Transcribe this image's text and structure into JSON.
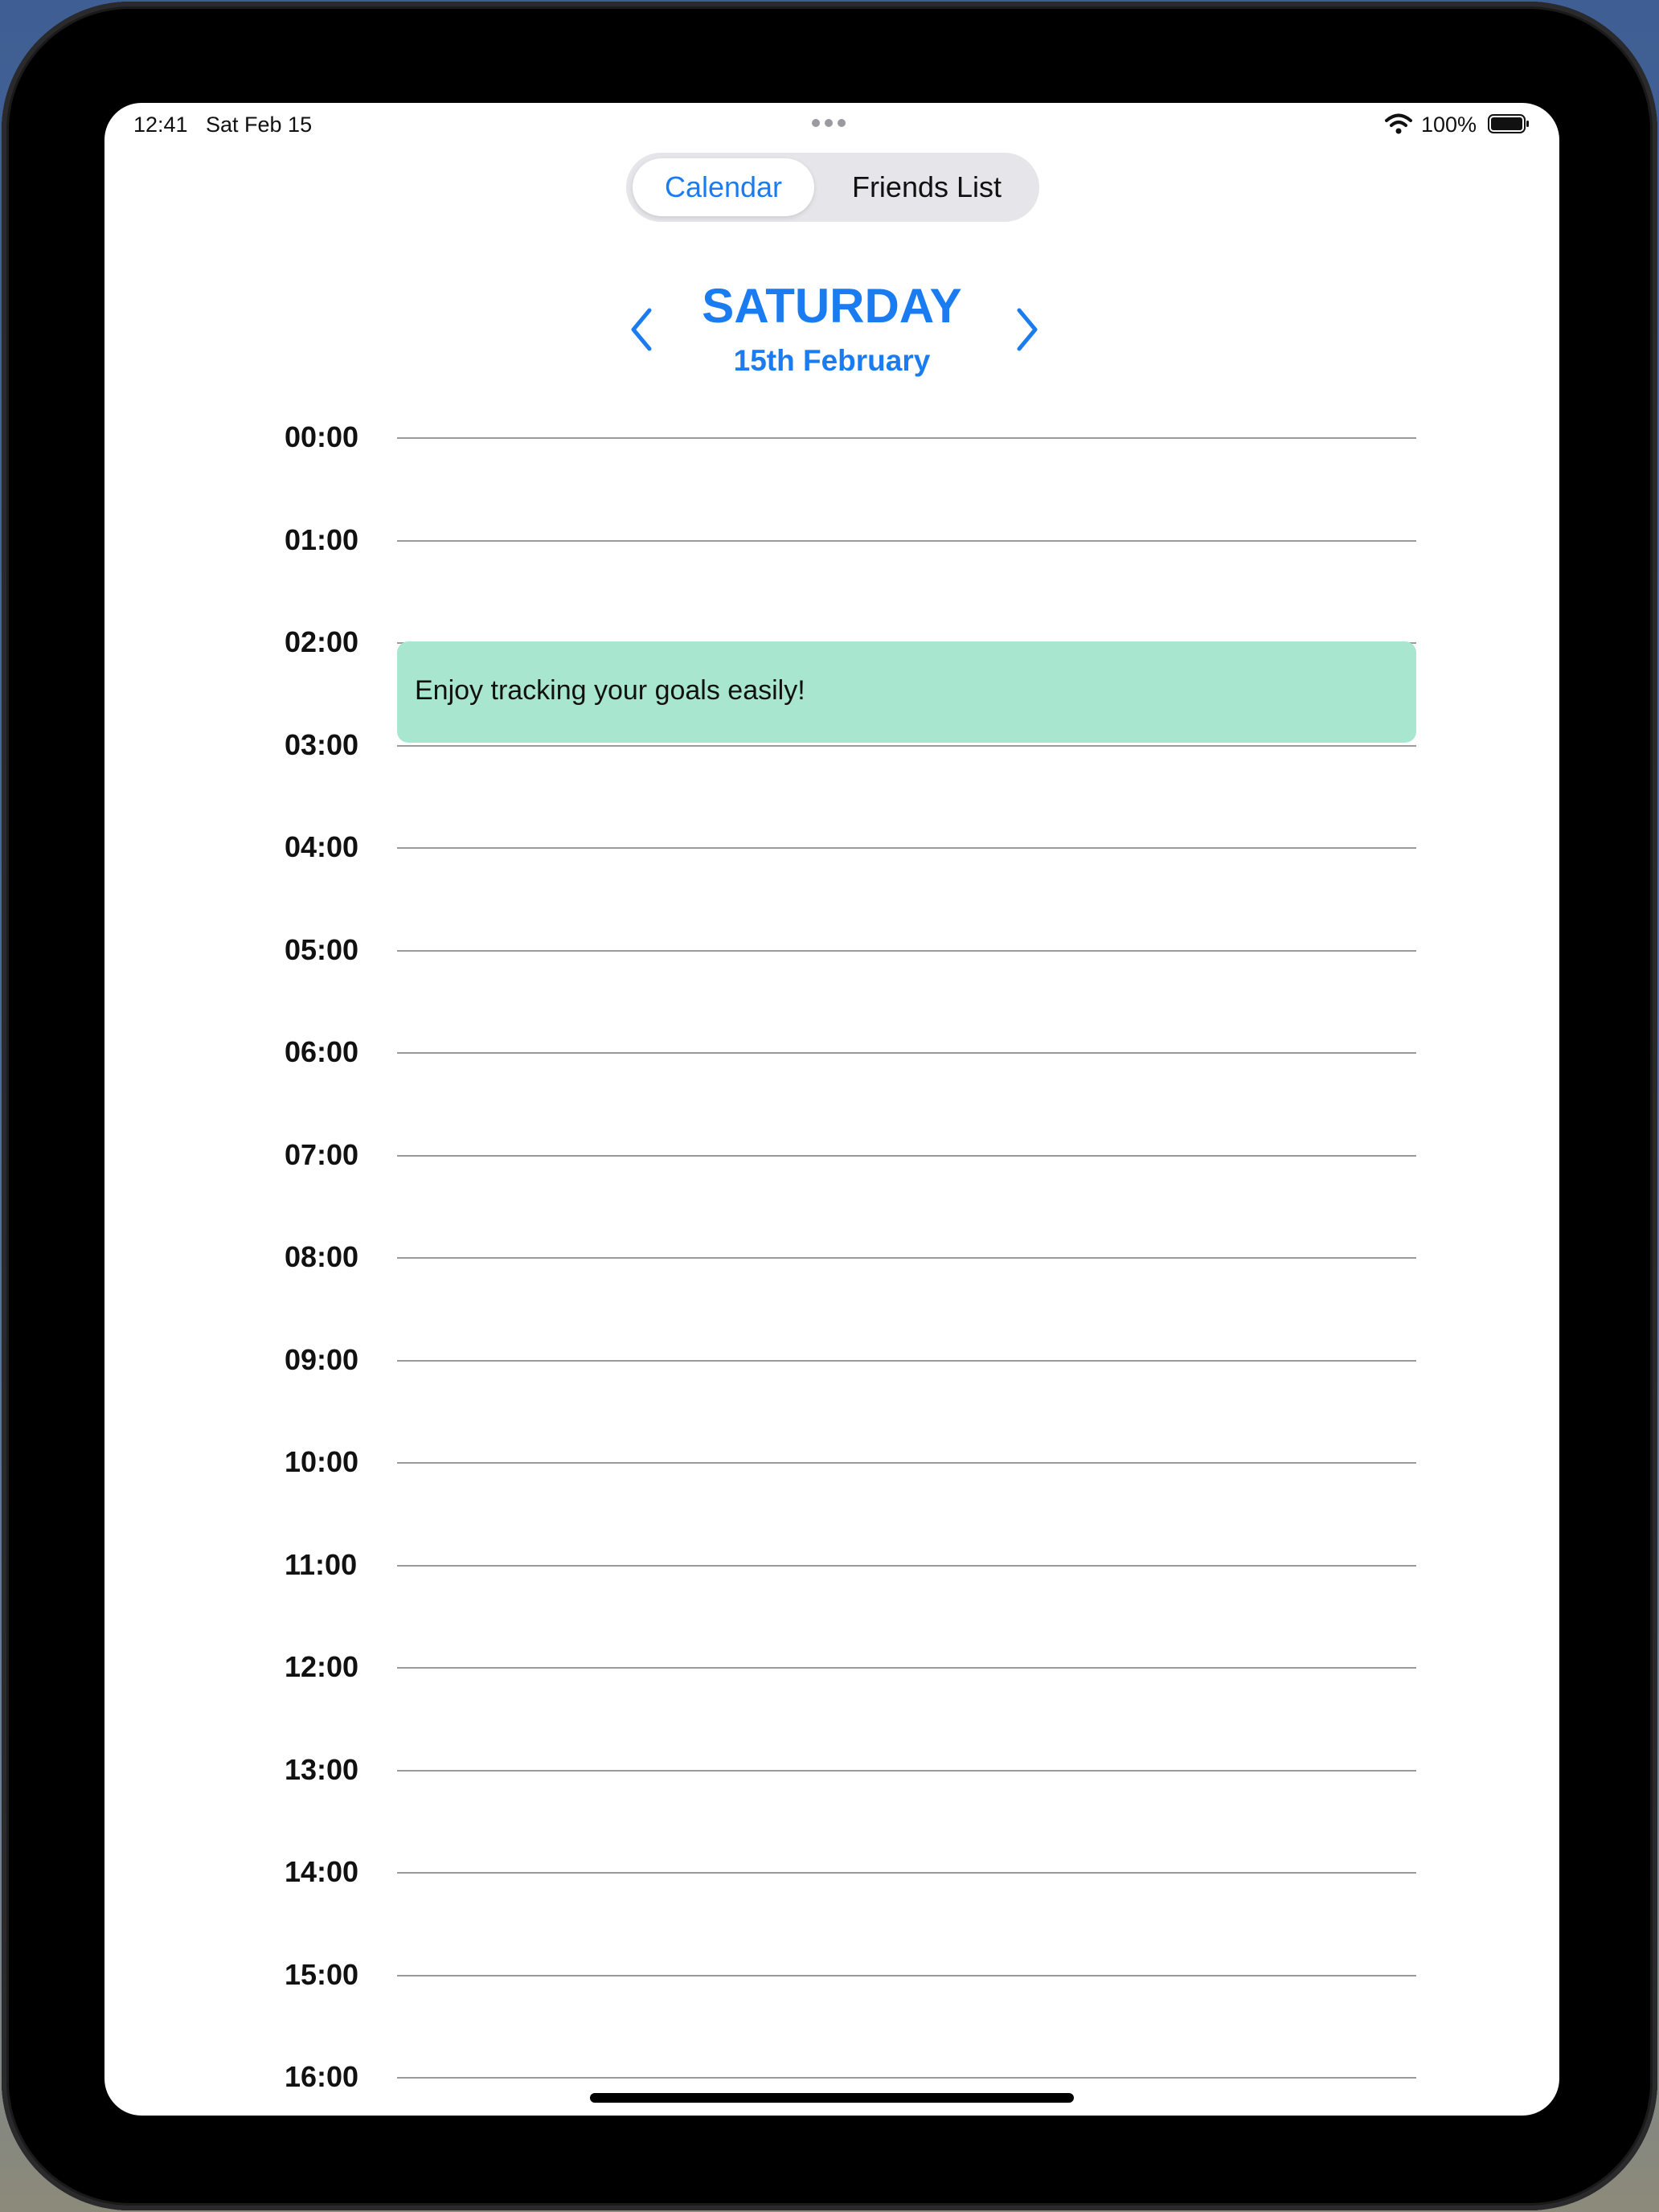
{
  "status_bar": {
    "time": "12:41",
    "date": "Sat Feb 15",
    "battery": "100%"
  },
  "segmented_control": {
    "tabs": [
      {
        "label": "Calendar",
        "selected": true
      },
      {
        "label": "Friends List",
        "selected": false
      }
    ]
  },
  "header": {
    "day": "SATURDAY",
    "date": "15th February"
  },
  "timeline": {
    "hours": [
      "00:00",
      "01:00",
      "02:00",
      "03:00",
      "04:00",
      "05:00",
      "06:00",
      "07:00",
      "08:00",
      "09:00",
      "10:00",
      "11:00",
      "12:00",
      "13:00",
      "14:00",
      "15:00",
      "16:00"
    ]
  },
  "events": [
    {
      "title": "Enjoy tracking your goals easily!",
      "start": "02:00",
      "end": "03:00",
      "color": "#a8e6cf"
    }
  ],
  "colors": {
    "accent": "#1a7cf0",
    "segment_bg": "#e5e5ea",
    "event": "#a8e6cf"
  },
  "icons": {
    "prev": "chevron-left-icon",
    "next": "chevron-right-icon",
    "wifi": "wifi-icon",
    "battery": "battery-icon"
  }
}
